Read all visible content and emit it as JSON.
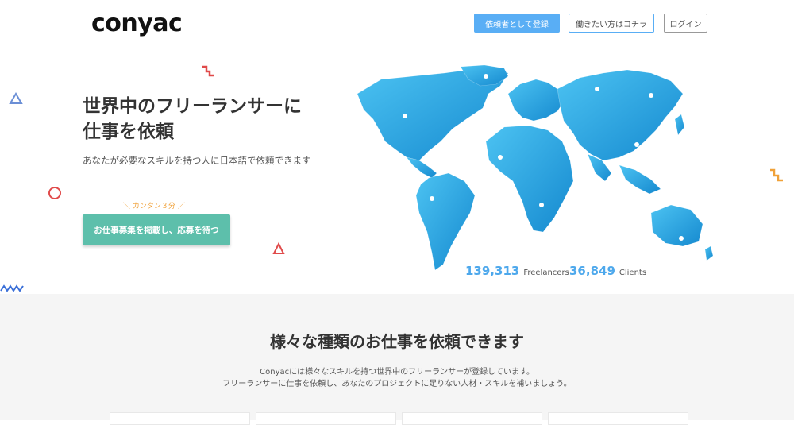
{
  "header": {
    "logo": "conyac",
    "register_client_label": "依頼者として登録",
    "register_worker_label": "働きたい方はコチラ",
    "login_label": "ログイン"
  },
  "hero": {
    "title_line1": "世界中のフリーランサーに",
    "title_line2": "仕事を依頼",
    "subtitle": "あなたが必要なスキルを持つ人に日本語で依頼できます",
    "hint": "カンタン３分",
    "cta_label": "お仕事募集を掲載し、応募を待つ"
  },
  "stats": {
    "freelancers_count": "139,313",
    "freelancers_label": "Freelancers",
    "clients_count": "36,849",
    "clients_label": "Clients"
  },
  "services": {
    "title": "様々な種類のお仕事を依頼できます",
    "desc_line1": "Conyacには様々なスキルを持つ世界中のフリーランサーが登録しています。",
    "desc_line2": "フリーランサーに仕事を依頼し、あなたのプロジェクトに足りない人材・スキルを補いましょう。"
  },
  "colors": {
    "primary_blue": "#59aef5",
    "cta_teal": "#5dbfab",
    "hint_orange": "#f0a138",
    "map_blue": "#1fa3e0"
  }
}
